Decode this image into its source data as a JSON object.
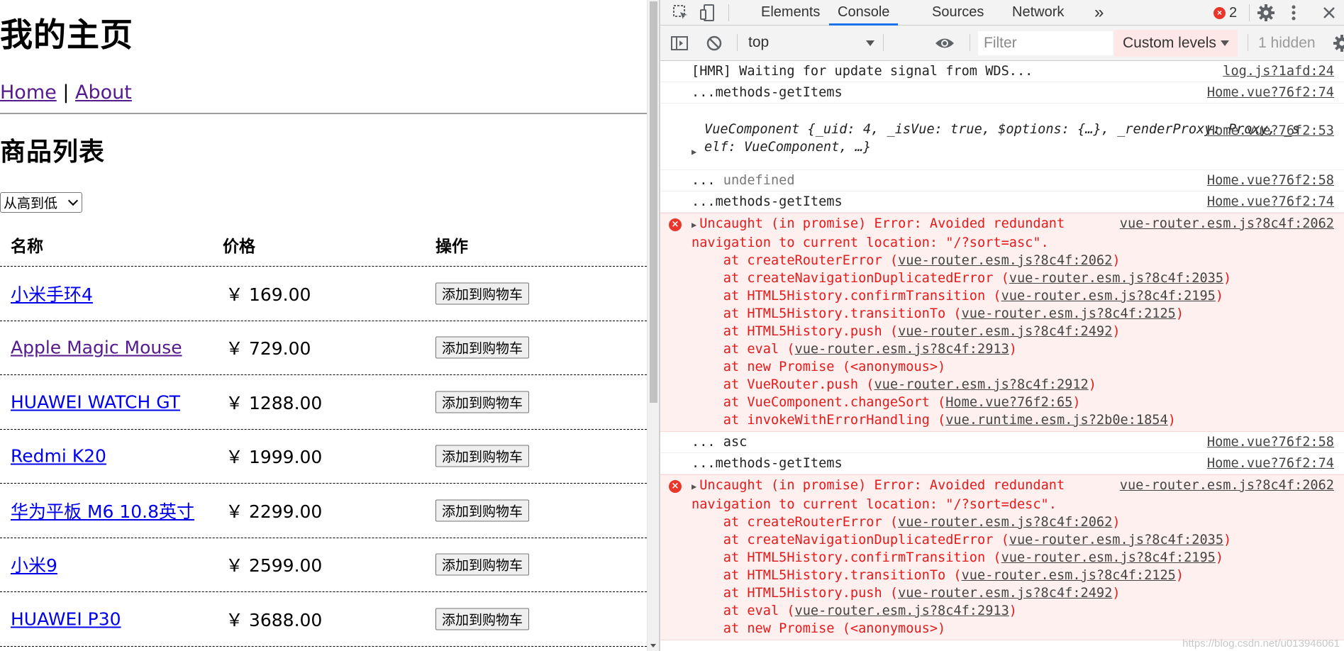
{
  "page": {
    "title": "我的主页",
    "nav": {
      "home": "Home",
      "separator": "|",
      "about": "About"
    },
    "list_title": "商品列表",
    "sort_select": "从高到低",
    "columns": [
      "名称",
      "价格",
      "操作"
    ],
    "products": [
      {
        "name": "小米手环4",
        "price": "￥ 169.00",
        "action": "添加到购物车"
      },
      {
        "name": "Apple Magic Mouse",
        "price": "￥ 729.00",
        "action": "添加到购物车"
      },
      {
        "name": "HUAWEI WATCH GT",
        "price": "￥ 1288.00",
        "action": "添加到购物车"
      },
      {
        "name": "Redmi K20",
        "price": "￥ 1999.00",
        "action": "添加到购物车"
      },
      {
        "name": "华为平板 M6 10.8英寸",
        "price": "￥ 2299.00",
        "action": "添加到购物车"
      },
      {
        "name": "小米9",
        "price": "￥ 2599.00",
        "action": "添加到购物车"
      },
      {
        "name": "HUAWEI P30",
        "price": "￥ 3688.00",
        "action": "添加到购物车"
      }
    ]
  },
  "devtools": {
    "tabs": [
      "Elements",
      "Console",
      "Sources",
      "Network"
    ],
    "more_tabs": "»",
    "error_count": "2",
    "context": "top",
    "filter_placeholder": "Filter",
    "levels": "Custom levels",
    "hidden": "1 hidden",
    "watermark": "https://blog.csdn.net/u013946061",
    "messages": [
      {
        "type": "log",
        "text": "[HMR] Waiting for update signal from WDS...",
        "src": "log.js?1afd:24"
      },
      {
        "type": "log",
        "text": "...methods-getItems",
        "src": "Home.vue?76f2:74"
      },
      {
        "type": "object",
        "src": "Home.vue?76f2:53",
        "line1": "VueComponent {_uid: 4, _isVue: true, $options: {…}, _renderProxy: Proxy, _s",
        "line2": "elf: VueComponent, …}"
      },
      {
        "type": "log",
        "text": "... ",
        "muted": "undefined",
        "src": "Home.vue?76f2:58"
      },
      {
        "type": "log",
        "text": "...methods-getItems",
        "src": "Home.vue?76f2:74"
      },
      {
        "type": "error",
        "src": "vue-router.esm.js?8c4f:2062",
        "line1": "Uncaught (in promise) Error: Avoided redundant",
        "line2": "navigation to current location: \"/?sort=asc\".",
        "stack": [
          {
            "pre": "    at createRouterError (",
            "link": "vue-router.esm.js?8c4f:2062",
            "post": ")"
          },
          {
            "pre": "    at createNavigationDuplicatedError (",
            "link": "vue-router.esm.js?8c4f:2035",
            "post": ")"
          },
          {
            "pre": "    at HTML5History.confirmTransition (",
            "link": "vue-router.esm.js?8c4f:2195",
            "post": ")"
          },
          {
            "pre": "    at HTML5History.transitionTo (",
            "link": "vue-router.esm.js?8c4f:2125",
            "post": ")"
          },
          {
            "pre": "    at HTML5History.push (",
            "link": "vue-router.esm.js?8c4f:2492",
            "post": ")"
          },
          {
            "pre": "    at eval (",
            "link": "vue-router.esm.js?8c4f:2913",
            "post": ")"
          },
          {
            "pre": "    at new Promise (<anonymous>)",
            "link": "",
            "post": ""
          },
          {
            "pre": "    at VueRouter.push (",
            "link": "vue-router.esm.js?8c4f:2912",
            "post": ")"
          },
          {
            "pre": "    at VueComponent.changeSort (",
            "link": "Home.vue?76f2:65",
            "post": ")"
          },
          {
            "pre": "    at invokeWithErrorHandling (",
            "link": "vue.runtime.esm.js?2b0e:1854",
            "post": ")"
          }
        ]
      },
      {
        "type": "log",
        "text": "... asc",
        "src": "Home.vue?76f2:58"
      },
      {
        "type": "log",
        "text": "...methods-getItems",
        "src": "Home.vue?76f2:74"
      },
      {
        "type": "error",
        "src": "vue-router.esm.js?8c4f:2062",
        "line1": "Uncaught (in promise) Error: Avoided redundant",
        "line2": "navigation to current location: \"/?sort=desc\".",
        "stack": [
          {
            "pre": "    at createRouterError (",
            "link": "vue-router.esm.js?8c4f:2062",
            "post": ")"
          },
          {
            "pre": "    at createNavigationDuplicatedError (",
            "link": "vue-router.esm.js?8c4f:2035",
            "post": ")"
          },
          {
            "pre": "    at HTML5History.confirmTransition (",
            "link": "vue-router.esm.js?8c4f:2195",
            "post": ")"
          },
          {
            "pre": "    at HTML5History.transitionTo (",
            "link": "vue-router.esm.js?8c4f:2125",
            "post": ")"
          },
          {
            "pre": "    at HTML5History.push (",
            "link": "vue-router.esm.js?8c4f:2492",
            "post": ")"
          },
          {
            "pre": "    at eval (",
            "link": "vue-router.esm.js?8c4f:2913",
            "post": ")"
          },
          {
            "pre": "    at new Promise (<anonymous>)",
            "link": "",
            "post": ""
          }
        ]
      }
    ]
  }
}
